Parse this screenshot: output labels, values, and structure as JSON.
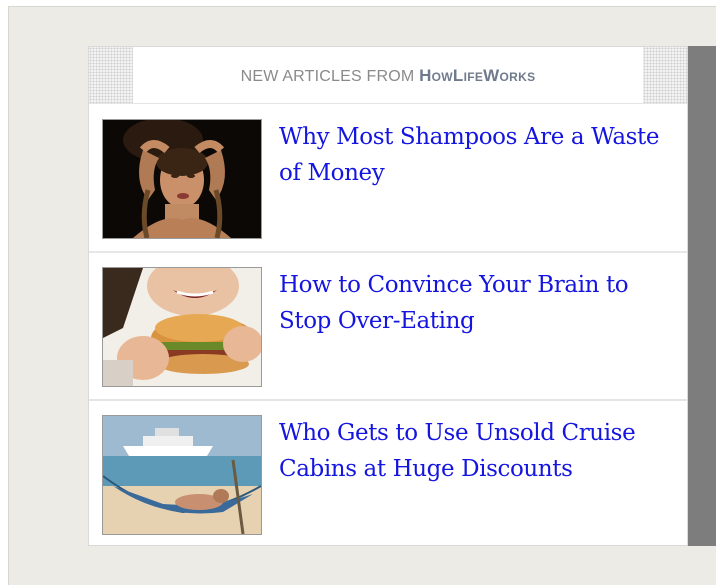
{
  "widget": {
    "header_prefix": "NEW ARTICLES FROM ",
    "header_brand": "HowLifeWorks"
  },
  "articles": [
    {
      "title": "Why Most Shampoos Are a Waste of Money",
      "thumb_icon": "woman-hair-photo"
    },
    {
      "title": "How to Convince Your Brain to Stop Over-Eating",
      "thumb_icon": "burger-eating-photo"
    },
    {
      "title": "Who Gets to Use Unsold Cruise Cabins at Huge Discounts",
      "thumb_icon": "cruise-hammock-photo"
    }
  ],
  "colors": {
    "link": "#1515e0",
    "background": "#edebe6",
    "shadow": "#7d7d7d"
  }
}
